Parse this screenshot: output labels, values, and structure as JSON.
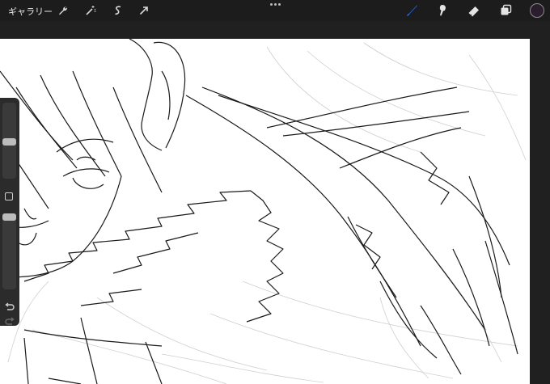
{
  "topbar": {
    "gallery_label": "ギャラリー",
    "left_tools": [
      "wrench-icon",
      "magic-wand-icon",
      "selection-icon",
      "transform-arrow-icon"
    ],
    "right_tools": [
      "brush-icon",
      "smudge-icon",
      "eraser-icon",
      "layers-icon"
    ],
    "active_tool": "brush-icon",
    "accent_color": "#2f6cf0",
    "current_color": "#2a1e2c"
  },
  "sidebar": {
    "brush_size_level": 0.48,
    "opacity_level": 1.0,
    "controls": [
      "brush-size-slider",
      "modify-button",
      "opacity-slider",
      "undo-icon",
      "redo-icon"
    ]
  }
}
